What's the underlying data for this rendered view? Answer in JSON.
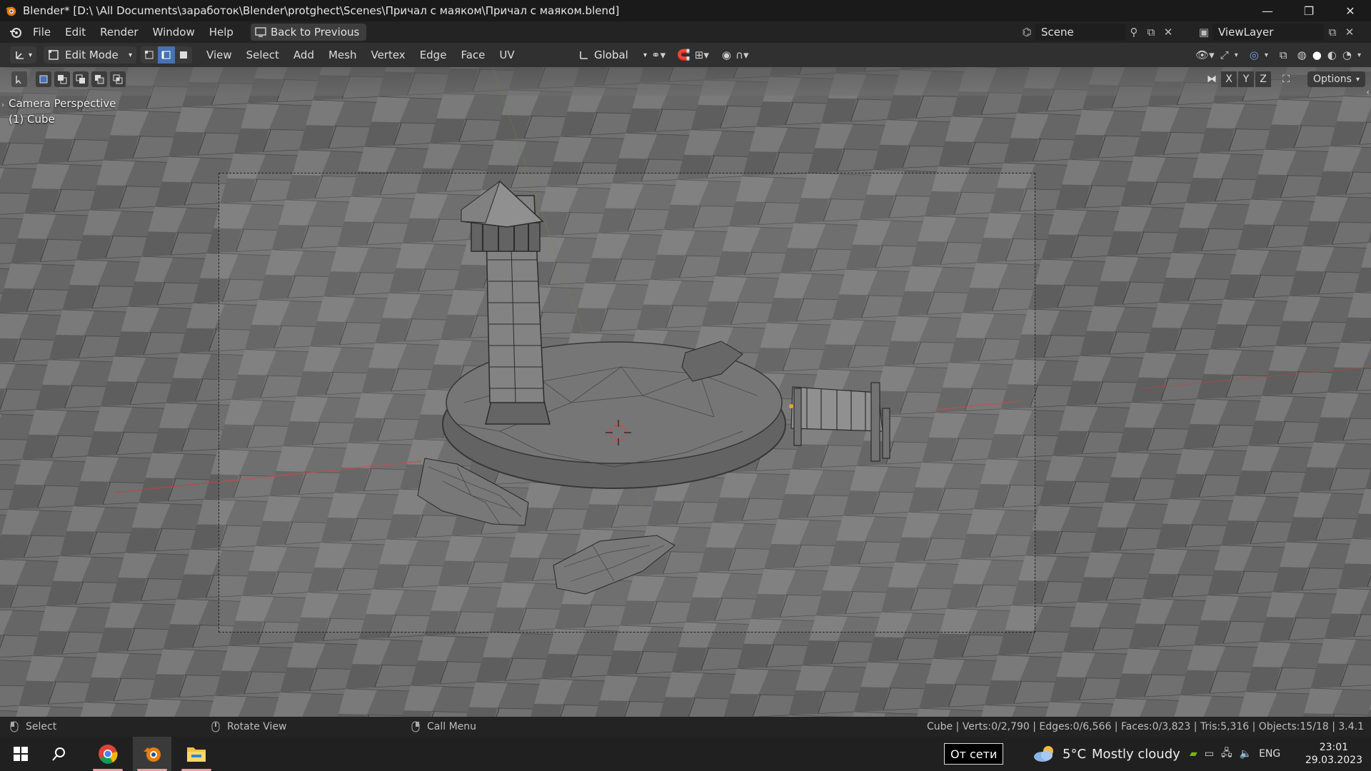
{
  "window": {
    "title": "Blender* [D:\\ \\All Documents\\заработок\\Blender\\protghect\\Scenes\\Причал с маяком\\Причал с маяком.blend]",
    "minimize": "—",
    "restore": "❐",
    "close": "✕"
  },
  "topbar": {
    "menus": [
      "File",
      "Edit",
      "Render",
      "Window",
      "Help"
    ],
    "back_button": "Back to Previous",
    "scene_name": "Scene",
    "view_layer": "ViewLayer"
  },
  "header": {
    "mode": "Edit Mode",
    "menus": [
      "View",
      "Select",
      "Add",
      "Mesh",
      "Vertex",
      "Edge",
      "Face",
      "UV"
    ],
    "transform_orientation": "Global",
    "options_label": "Options",
    "axes": [
      "X",
      "Y",
      "Z"
    ]
  },
  "viewport": {
    "view_name": "Camera Perspective",
    "object_name": "(1) Cube"
  },
  "statusbar": {
    "hint_left": "Select",
    "hint_middle": "Rotate View",
    "hint_right": "Call Menu",
    "stats": "Cube | Verts:0/2,790 | Edges:0/6,566 | Faces:0/3,823 | Tris:5,316 | Objects:15/18 | 3.4.1"
  },
  "taskbar": {
    "network_text": "От сети",
    "weather_temp": "5°C",
    "weather_desc": "Mostly cloudy",
    "language": "ENG",
    "time": "23:01",
    "date": "29.03.2023"
  },
  "colors": {
    "accent": "#4772b3",
    "blender_orange": "#e87d0d",
    "viewport_bg": "#6d6d6d"
  }
}
